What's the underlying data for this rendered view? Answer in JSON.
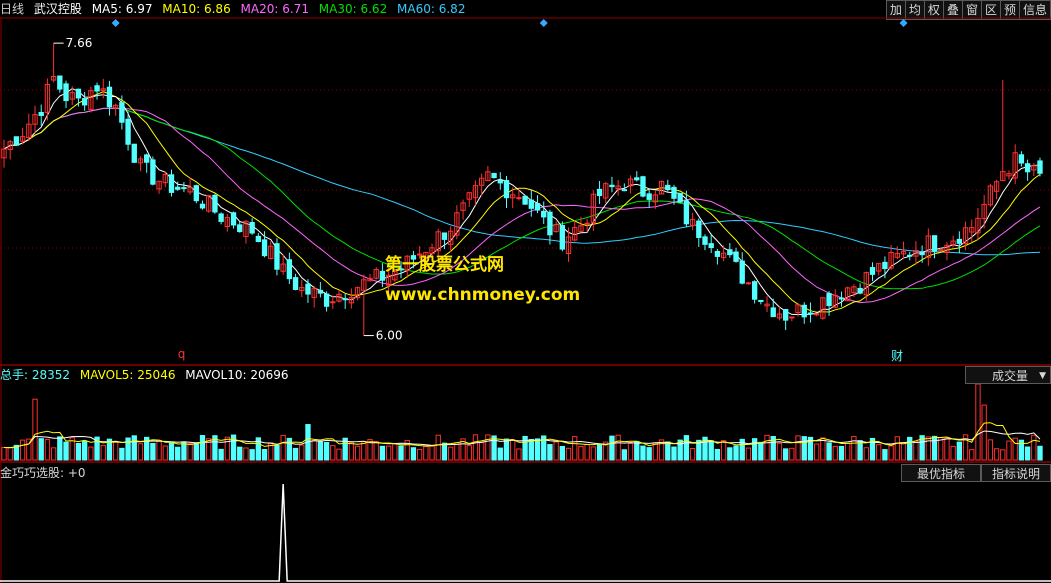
{
  "header": {
    "period": "日线",
    "stock_name": "武汉控股",
    "ma": [
      {
        "label": "MA5: 6.97",
        "color": "#ffffff"
      },
      {
        "label": "MA10: 6.86",
        "color": "#ffff00"
      },
      {
        "label": "MA20: 6.71",
        "color": "#ff66ff"
      },
      {
        "label": "MA30: 6.62",
        "color": "#00e000"
      },
      {
        "label": "MA60: 6.82",
        "color": "#33ccff"
      }
    ]
  },
  "toolbar": [
    "加",
    "均",
    "权",
    "叠",
    "窗",
    "区",
    "预",
    "信息"
  ],
  "volume_header": {
    "total": "总手: 28352",
    "mavol5": "MAVOL5: 25046",
    "mavol10": "MAVOL10: 20696",
    "selector": "成交量"
  },
  "indicator_header": {
    "label": "金巧巧选股: +0",
    "best_button": "最优指标",
    "explain_button": "指标说明"
  },
  "annotations": {
    "high": "7.66",
    "low": "6.00",
    "marker_q": "q",
    "marker_cai": "财"
  },
  "watermark": {
    "line1": "第一股票公式网",
    "line2": "www.chnmoney.com"
  },
  "colors": {
    "up": "#ff3030",
    "down": "#54ffff",
    "grid": "#8b0000",
    "ma5": "#ffffff",
    "ma10": "#ffff00",
    "ma20": "#ff66ff",
    "ma30": "#00e000",
    "ma60": "#33ccff",
    "signal": "#ffffff"
  },
  "chart_data": {
    "type": "candlestick",
    "price_range": [
      5.85,
      7.78
    ],
    "highest": 7.66,
    "lowest": 6.0,
    "keypoints": [
      [
        0,
        7.06
      ],
      [
        3,
        7.16
      ],
      [
        6,
        7.3
      ],
      [
        8,
        7.46
      ],
      [
        10,
        7.36
      ],
      [
        12,
        7.33
      ],
      [
        15,
        7.42
      ],
      [
        18,
        7.3
      ],
      [
        22,
        6.95
      ],
      [
        26,
        6.86
      ],
      [
        30,
        6.82
      ],
      [
        35,
        6.68
      ],
      [
        40,
        6.6
      ],
      [
        45,
        6.36
      ],
      [
        48,
        6.26
      ],
      [
        52,
        6.21
      ],
      [
        56,
        6.27
      ],
      [
        60,
        6.32
      ],
      [
        64,
        6.38
      ],
      [
        68,
        6.5
      ],
      [
        72,
        6.62
      ],
      [
        76,
        6.8
      ],
      [
        78,
        6.9
      ],
      [
        81,
        6.84
      ],
      [
        84,
        6.78
      ],
      [
        88,
        6.6
      ],
      [
        90,
        6.55
      ],
      [
        93,
        6.63
      ],
      [
        96,
        6.8
      ],
      [
        100,
        6.87
      ],
      [
        103,
        6.82
      ],
      [
        106,
        6.85
      ],
      [
        108,
        6.76
      ],
      [
        111,
        6.62
      ],
      [
        114,
        6.55
      ],
      [
        117,
        6.42
      ],
      [
        120,
        6.3
      ],
      [
        123,
        6.18
      ],
      [
        126,
        6.12
      ],
      [
        129,
        6.15
      ],
      [
        132,
        6.2
      ],
      [
        135,
        6.26
      ],
      [
        138,
        6.3
      ],
      [
        141,
        6.38
      ],
      [
        144,
        6.44
      ],
      [
        147,
        6.5
      ],
      [
        150,
        6.53
      ],
      [
        153,
        6.56
      ],
      [
        156,
        6.62
      ],
      [
        159,
        6.8
      ],
      [
        161,
        6.94
      ],
      [
        163,
        6.99
      ],
      [
        165,
        6.93
      ],
      [
        167,
        6.9
      ]
    ],
    "volume_range": [
      0,
      9
    ],
    "volume_spikes": [
      [
        5,
        7.2
      ],
      [
        49,
        4.2
      ],
      [
        157,
        9.0
      ],
      [
        158,
        6.5
      ]
    ],
    "signal_index": 45,
    "signal_value": 1
  }
}
